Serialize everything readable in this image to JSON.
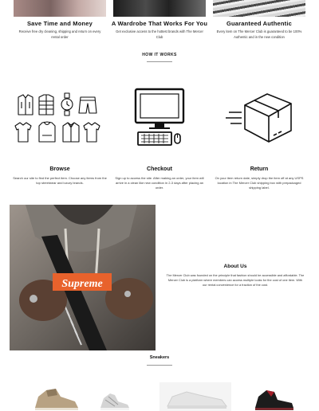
{
  "features": [
    {
      "title": "Save Time and Money",
      "desc": "Receive free dry cleaning, shipping and return on every rental order"
    },
    {
      "title": "A Wardrobe That Works For You",
      "desc": "Get exclusive access to the hottest brands with The Mercer Club"
    },
    {
      "title": "Guaranteed Authentic",
      "desc": "Every item on The Mercer Club is guaranteed to be 100% Authentic and in the new condition"
    }
  ],
  "how_it_works": {
    "heading": "HOW IT WORKS",
    "steps": [
      {
        "title": "Browse",
        "icon": "clothing-icon",
        "desc": "Search our site to find the perfect item. Choose any items from the top streetwear and luxury brands."
      },
      {
        "title": "Checkout",
        "icon": "computer-icon",
        "desc": "Sign up to access the site. After making an order, your item will arrive in a clean like new condition in 2-3 days after placing an order."
      },
      {
        "title": "Return",
        "icon": "delivery-box-icon",
        "desc": "On your item return date, simply drop the item off at any USPS location in The Mercer Club shipping box with prepackaged shipping label."
      }
    ]
  },
  "about": {
    "title": "About Us",
    "body": "The Mercer Club was founded on the principle that fashion should be accessible and affordable. The Mercer Club is a platform where members can access multiple looks for the cost of one item. With our rental convenience for a fraction of the cost.",
    "photo_text": "Supreme"
  },
  "sneakers": {
    "heading": "Sneakers"
  }
}
